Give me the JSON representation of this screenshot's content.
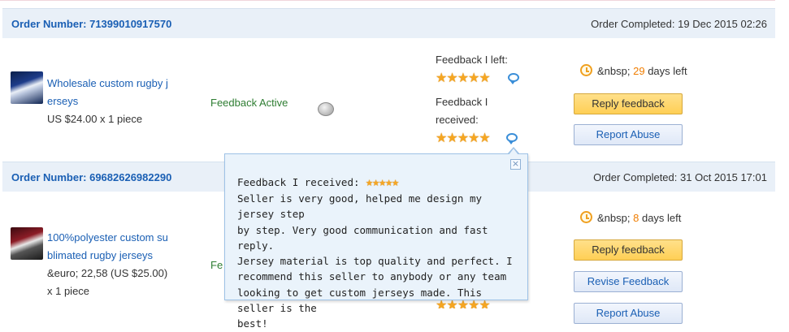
{
  "orders": [
    {
      "order_label": "Order Number:",
      "order_number": "71399010917570",
      "completed_label": "Order Completed:",
      "completed_date": "19 Dec 2015 02:26",
      "product_line1": "Wholesale custom rugby j",
      "product_line2": "erseys",
      "price": "US $24.00 x 1 piece",
      "status": "Feedback Active",
      "feedback_left_label": "Feedback I left:",
      "feedback_received_line1": "Feedback I",
      "feedback_received_line2": "received:",
      "stars_left": "★★★★★",
      "stars_received": "★★★★★",
      "days_prefix": "&nbsp;",
      "days_num": "29",
      "days_suffix": "days left",
      "reply_button": "Reply feedback",
      "report_button": "Report Abuse"
    },
    {
      "order_label": "Order Number:",
      "order_number": "69682626982290",
      "completed_label": "Order Completed:",
      "completed_date": "31 Oct 2015 17:01",
      "product_line1": "100%polyester custom su",
      "product_line2": "blimated rugby jerseys",
      "price_line1": "&euro; 22,58 (US $25.00)",
      "price_line2": "x 1 piece",
      "status_partial": "Fe",
      "days_prefix": "&nbsp;",
      "days_num": "8",
      "days_suffix": "days left",
      "reply_button": "Reply feedback",
      "revise_button": "Revise Feedback",
      "report_button": "Report Abuse",
      "stars_partial": "★★★★★"
    }
  ],
  "popup": {
    "heading": "Feedback I received:",
    "stars": "★★★★★",
    "lines": [
      "Seller is very good, helped me design my jersey step",
      "by step. Very good communication and fast reply.",
      "Jersey material is top quality and perfect. I",
      "recommend this seller to anybody or any team",
      "looking to get custom jerseys made. This seller is the",
      "best!"
    ],
    "close_glyph": "×"
  },
  "icons": {
    "clock": "clock-icon",
    "chat": "chat-bubble-icon",
    "smiley": "smiley-icon",
    "close": "close-icon"
  },
  "colors": {
    "link": "#1a5fb4",
    "accent_orange": "#f07d00",
    "status_green": "#2e7d32",
    "header_bg": "#e9f0f8",
    "popup_bg": "#eaf3fb"
  }
}
